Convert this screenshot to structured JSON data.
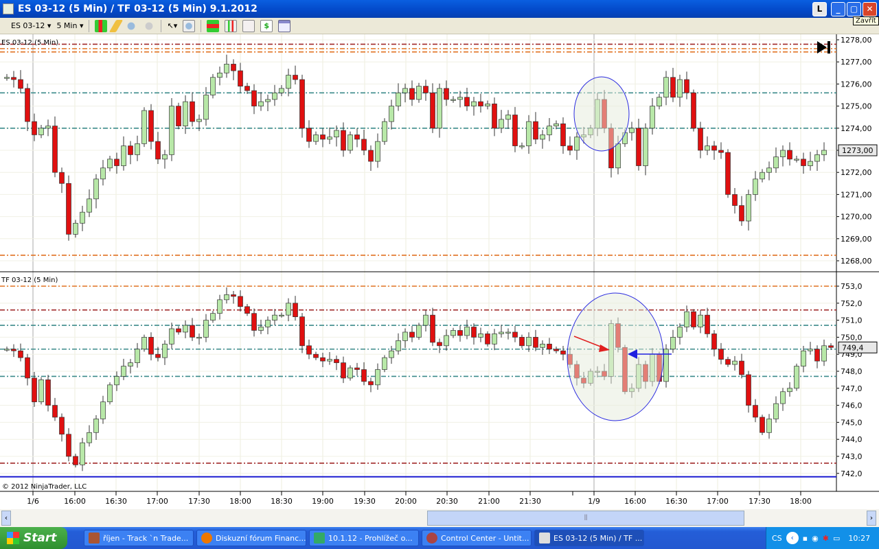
{
  "window": {
    "title": "ES 03-12 (5 Min) / TF 03-12 (5 Min)  9.1.2012",
    "tooltip": "Zavřít",
    "btn_l": "L",
    "btn_min": "_",
    "btn_max": "▢",
    "btn_close": "✕"
  },
  "toolbar": {
    "instrument": "ES 03-12",
    "interval": "5 Min"
  },
  "panels": [
    {
      "label": "ES 03-12 (5 Min)",
      "ticks": [
        "1278,00",
        "1277,00",
        "1276,00",
        "1275,00",
        "1274,00",
        "1273,00",
        "1272,00",
        "1271,00",
        "1270,00",
        "1269,00",
        "1268,00"
      ],
      "tick_values": [
        1278,
        1277,
        1276,
        1275,
        1274,
        1273,
        1272,
        1271,
        1270,
        1269,
        1268
      ],
      "current_price": "1273,00",
      "current_value": 1273.0,
      "levels": [
        {
          "v": 1277.8,
          "c": "#a02828"
        },
        {
          "v": 1277.6,
          "c": "#e07020"
        },
        {
          "v": 1277.45,
          "c": "#e07020"
        },
        {
          "v": 1275.6,
          "c": "#3a8a8a"
        },
        {
          "v": 1274.0,
          "c": "#3a8a8a"
        },
        {
          "v": 1268.25,
          "c": "#e07020"
        }
      ],
      "close": [
        1276.3,
        1276.2,
        1275.8,
        1274.3,
        1273.7,
        1274,
        1274.1,
        1272,
        1271.5,
        1269.2,
        1269.7,
        1270.2,
        1270.8,
        1271.7,
        1272.2,
        1272.6,
        1272.3,
        1273.2,
        1272.8,
        1273.3,
        1274.8,
        1273.4,
        1272.6,
        1272.8,
        1275,
        1274.1,
        1275.2,
        1274.3,
        1274.4,
        1275.5,
        1276.3,
        1276.5,
        1276.9,
        1276.6,
        1275.9,
        1275.7,
        1275,
        1275.2,
        1275.3,
        1275.6,
        1275.8,
        1276.4,
        1276.2,
        1274,
        1273.4,
        1273.7,
        1273.5,
        1273.6,
        1273.9,
        1273,
        1273.7,
        1273.5,
        1273,
        1272.5,
        1273.4,
        1274.3,
        1275,
        1275.6,
        1275.8,
        1275.3,
        1275.9,
        1275.6,
        1274,
        1275.8,
        1275.3,
        1275.3,
        1275.4,
        1275,
        1275.2,
        1275,
        1275.1,
        1274,
        1274.4,
        1274.6,
        1273.2,
        1273.2,
        1274.3,
        1273.5,
        1273.7,
        1274.1,
        1274.2,
        1273.2,
        1273,
        1273.6,
        1273.7,
        1274,
        1275.3,
        1274,
        1272.2,
        1273.3,
        1273.8,
        1274,
        1272.3,
        1274,
        1275,
        1275.4,
        1276.3,
        1275.4,
        1276.2,
        1275.6,
        1274,
        1273,
        1273.2,
        1273,
        1272.9,
        1271,
        1270.5,
        1269.8,
        1271,
        1271.7,
        1272,
        1272.2,
        1272.7,
        1273,
        1272.6,
        1272.6,
        1272.3,
        1272.5,
        1272.8,
        1273
      ]
    },
    {
      "label": "TF 03-12 (5 Min)",
      "ticks": [
        "753,0",
        "752,0",
        "751,0",
        "750,0",
        "749,0",
        "748,0",
        "747,0",
        "746,0",
        "745,0",
        "744,0",
        "743,0",
        "742,0"
      ],
      "tick_values": [
        753,
        752,
        751,
        750,
        749,
        748,
        747,
        746,
        745,
        744,
        743,
        742
      ],
      "current_price": "749,4",
      "current_value": 749.4,
      "levels": [
        {
          "v": 753.0,
          "c": "#e07020"
        },
        {
          "v": 751.6,
          "c": "#a02828"
        },
        {
          "v": 750.7,
          "c": "#3a8a8a"
        },
        {
          "v": 749.3,
          "c": "#3a8a8a"
        },
        {
          "v": 747.7,
          "c": "#3a8a8a"
        },
        {
          "v": 742.6,
          "c": "#a02828"
        },
        {
          "v": 741.8,
          "c": "#1a1ad0",
          "solid": true
        }
      ],
      "close": [
        749.3,
        749.2,
        748.8,
        747.6,
        746.2,
        747.5,
        746,
        745.3,
        744.3,
        743,
        742.5,
        743.8,
        744.4,
        745.2,
        746.2,
        747.2,
        747.7,
        748.3,
        748.5,
        749.3,
        750,
        749,
        748.8,
        749.6,
        750.5,
        750.3,
        750.7,
        750,
        750,
        751,
        751.4,
        752.2,
        752.5,
        752.4,
        751.8,
        751.4,
        750.4,
        750.6,
        751,
        751.3,
        751.3,
        752,
        751.2,
        749.5,
        749,
        748.8,
        748.6,
        748.7,
        748.5,
        747.6,
        748.2,
        748.1,
        747.4,
        747.2,
        748.1,
        748.8,
        749.2,
        749.8,
        750.3,
        750,
        750.7,
        751.3,
        749.7,
        749.5,
        750.1,
        750.4,
        750.1,
        750.6,
        750,
        750.2,
        749.6,
        750.2,
        750.3,
        750.3,
        750,
        749.5,
        750,
        749.4,
        749.6,
        749.3,
        749.2,
        749,
        748.4,
        747.6,
        747.3,
        748,
        748,
        747.7,
        750.8,
        749.4,
        746.8,
        747,
        748.4,
        747.4,
        749,
        747.4,
        749.3,
        750,
        750.6,
        751.5,
        750.6,
        751.3,
        750.2,
        749.3,
        748.7,
        748.4,
        748.6,
        747.8,
        746,
        745.3,
        744.4,
        745.2,
        746.1,
        746.8,
        747,
        748.3,
        749.2,
        749.3,
        748.6,
        749.5,
        749.4,
        749.2,
        749.4
      ]
    }
  ],
  "xaxis": {
    "labels": [
      "1/6",
      "16:00",
      "16:30",
      "17:00",
      "17:30",
      "18:00",
      "18:30",
      "19:00",
      "19:30",
      "20:00",
      "20:30",
      "21:00",
      "21:30",
      "1/9",
      "16:00",
      "16:30",
      "17:00",
      "17:30",
      "18:00"
    ]
  },
  "copyright": "© 2012 NinjaTrader, LLC",
  "colors": {
    "up": "#b8e8a8",
    "down": "#e01010",
    "outline": "#404040"
  },
  "taskbar": {
    "start": "Start",
    "tasks": [
      "říjen - Track `n Trade...",
      "Diskuzní fórum Financ...",
      "10.1.12 - Prohlížeč o...",
      "Control Center - Untit...",
      "ES 03-12 (5 Min) / TF ..."
    ],
    "lang": "CS",
    "clock": "10:27"
  }
}
